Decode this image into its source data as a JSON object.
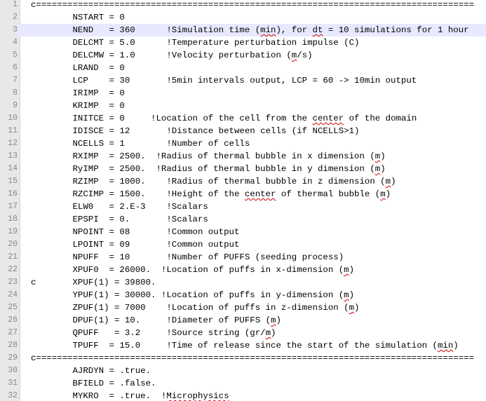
{
  "editor": {
    "current_line": 3,
    "lines": [
      {
        "n": "1",
        "segments": [
          {
            "t": "c====================================================================================",
            "s": false
          }
        ]
      },
      {
        "n": "2",
        "segments": [
          {
            "t": "        NSTART = 0",
            "s": false
          }
        ]
      },
      {
        "n": "3",
        "segments": [
          {
            "t": "        NEND   = 360      !Simulation time (",
            "s": false
          },
          {
            "t": "min",
            "s": true
          },
          {
            "t": "), for ",
            "s": false
          },
          {
            "t": "dt",
            "s": true
          },
          {
            "t": " = 10 simulations for 1 hour",
            "s": false
          }
        ]
      },
      {
        "n": "4",
        "segments": [
          {
            "t": "        DELCMT = 5.0      !Temperature perturbation impulse (C)",
            "s": false
          }
        ]
      },
      {
        "n": "5",
        "segments": [
          {
            "t": "        DELCMW = 1.0      !Velocity perturbation (",
            "s": false
          },
          {
            "t": "m",
            "s": true
          },
          {
            "t": "/s)",
            "s": false
          }
        ]
      },
      {
        "n": "6",
        "segments": [
          {
            "t": "        LRAND  = 0",
            "s": false
          }
        ]
      },
      {
        "n": "7",
        "segments": [
          {
            "t": "        LCP    = 30       !5min intervals output, LCP = 60 -> 10min output",
            "s": false
          }
        ]
      },
      {
        "n": "8",
        "segments": [
          {
            "t": "        IRIMP  = 0",
            "s": false
          }
        ]
      },
      {
        "n": "9",
        "segments": [
          {
            "t": "        KRIMP  = 0",
            "s": false
          }
        ]
      },
      {
        "n": "10",
        "segments": [
          {
            "t": "        INITCE = 0     !Location of the cell from the ",
            "s": false
          },
          {
            "t": "center",
            "s": true
          },
          {
            "t": " of the domain",
            "s": false
          }
        ]
      },
      {
        "n": "11",
        "segments": [
          {
            "t": "        IDISCE = 12       !Distance between cells (if NCELLS>1)",
            "s": false
          }
        ]
      },
      {
        "n": "12",
        "segments": [
          {
            "t": "        NCELLS = 1        !Number of cells",
            "s": false
          }
        ]
      },
      {
        "n": "13",
        "segments": [
          {
            "t": "        RXIMP  = 2500.  !Radius of thermal bubble in x dimension (",
            "s": false
          },
          {
            "t": "m",
            "s": true
          },
          {
            "t": ")",
            "s": false
          }
        ]
      },
      {
        "n": "14",
        "segments": [
          {
            "t": "        RyIMP  = 2500.  !Radius of thermal bubble in y dimension (",
            "s": false
          },
          {
            "t": "m",
            "s": true
          },
          {
            "t": ")",
            "s": false
          }
        ]
      },
      {
        "n": "15",
        "segments": [
          {
            "t": "        RZIMP  = 1000.    !Radius of thermal bubble in z dimension (",
            "s": false
          },
          {
            "t": "m",
            "s": true
          },
          {
            "t": ")",
            "s": false
          }
        ]
      },
      {
        "n": "16",
        "segments": [
          {
            "t": "        RZCIMP = 1500.    !Height of the ",
            "s": false
          },
          {
            "t": "center",
            "s": true
          },
          {
            "t": " of thermal bubble (",
            "s": false
          },
          {
            "t": "m",
            "s": true
          },
          {
            "t": ")",
            "s": false
          }
        ]
      },
      {
        "n": "17",
        "segments": [
          {
            "t": "        ELW0   = 2.E-3    !Scalars",
            "s": false
          }
        ]
      },
      {
        "n": "18",
        "segments": [
          {
            "t": "        EPSPI  = 0.       !Scalars",
            "s": false
          }
        ]
      },
      {
        "n": "19",
        "segments": [
          {
            "t": "        NPOINT = 08       !Common output",
            "s": false
          }
        ]
      },
      {
        "n": "20",
        "segments": [
          {
            "t": "        LPOINT = 09       !Common output",
            "s": false
          }
        ]
      },
      {
        "n": "21",
        "segments": [
          {
            "t": "        NPUFF  = 10       !Number of PUFFS (seeding process)",
            "s": false
          }
        ]
      },
      {
        "n": "22",
        "segments": [
          {
            "t": "        XPUF0  = 26000.  !Location of puffs in x-dimension (",
            "s": false
          },
          {
            "t": "m",
            "s": true
          },
          {
            "t": ")",
            "s": false
          }
        ]
      },
      {
        "n": "23",
        "segments": [
          {
            "t": "c       XPUF(1) = 39800.",
            "s": false
          }
        ]
      },
      {
        "n": "24",
        "segments": [
          {
            "t": "        YPUF(1) = 30000. !Location of puffs in y-dimension (",
            "s": false
          },
          {
            "t": "m",
            "s": true
          },
          {
            "t": ")",
            "s": false
          }
        ]
      },
      {
        "n": "25",
        "segments": [
          {
            "t": "        ZPUF(1) = 7000    !Location of puffs in z-dimension (",
            "s": false
          },
          {
            "t": "m",
            "s": true
          },
          {
            "t": ")",
            "s": false
          }
        ]
      },
      {
        "n": "26",
        "segments": [
          {
            "t": "        DPUF(1) = 10.     !Diameter of PUFFS (",
            "s": false
          },
          {
            "t": "m",
            "s": true
          },
          {
            "t": ")",
            "s": false
          }
        ]
      },
      {
        "n": "27",
        "segments": [
          {
            "t": "        QPUFF   = 3.2     !Source string (gr/",
            "s": false
          },
          {
            "t": "m",
            "s": true
          },
          {
            "t": ")",
            "s": false
          }
        ]
      },
      {
        "n": "28",
        "segments": [
          {
            "t": "        TPUFF  = 15.0     !Time of release since the start of the simulation (",
            "s": false
          },
          {
            "t": "min",
            "s": true
          },
          {
            "t": ")",
            "s": false
          }
        ]
      },
      {
        "n": "29",
        "segments": [
          {
            "t": "c====================================================================================",
            "s": false
          }
        ]
      },
      {
        "n": "30",
        "segments": [
          {
            "t": "        AJRDYN = .true.",
            "s": false
          }
        ]
      },
      {
        "n": "31",
        "segments": [
          {
            "t": "        BFIELD = .false.",
            "s": false
          }
        ]
      },
      {
        "n": "32",
        "segments": [
          {
            "t": "        MYKRO  = .true.  !",
            "s": false
          },
          {
            "t": "Microphysics",
            "s": true
          }
        ]
      }
    ]
  }
}
